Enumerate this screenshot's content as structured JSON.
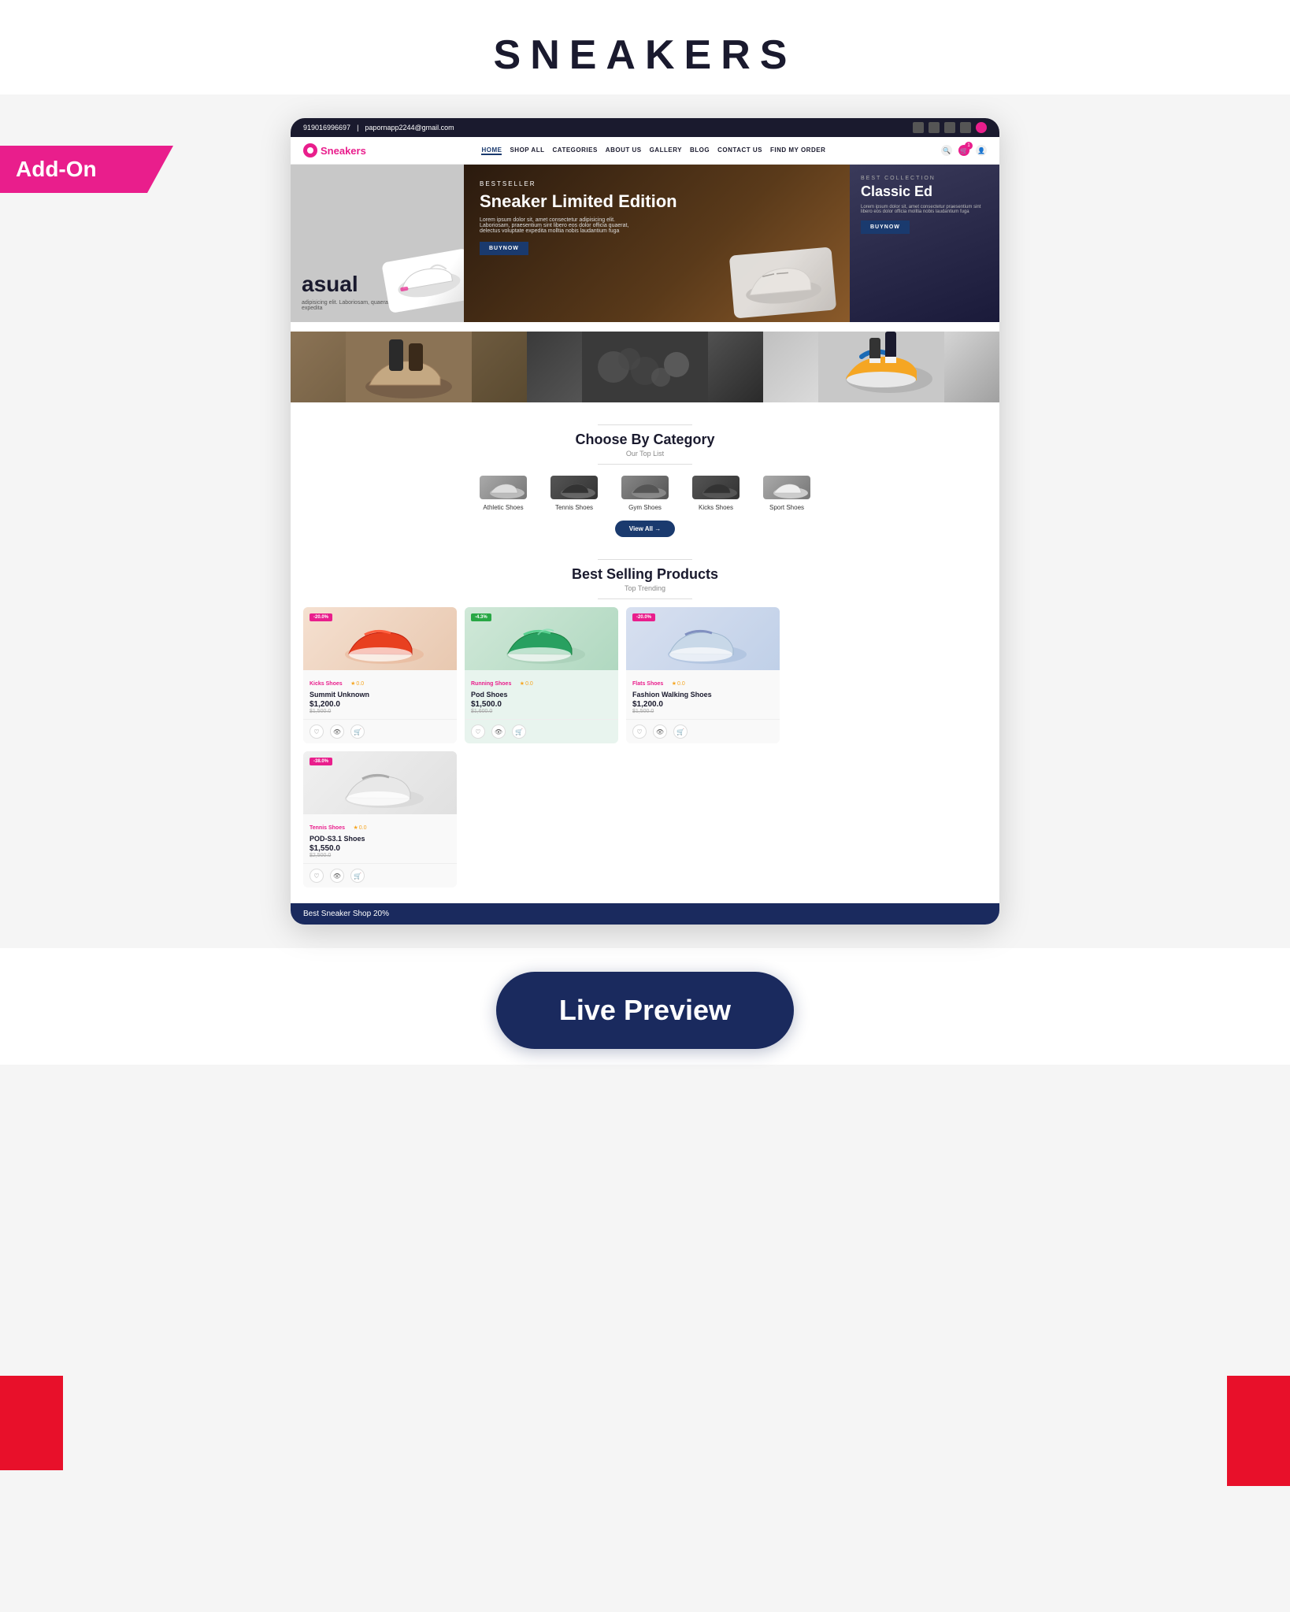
{
  "page": {
    "title": "SNEAKERS",
    "addon_badge": "Add-On"
  },
  "topbar": {
    "phone": "919016996697",
    "email": "papornapp2244@gmail.com",
    "social_icons": [
      "facebook",
      "twitter",
      "instagram",
      "linkedin",
      "user"
    ]
  },
  "nav": {
    "logo": "Sneakers",
    "links": [
      "HOME",
      "SHOP ALL",
      "CATEGORIES",
      "ABOUT US",
      "GALLERY",
      "BLOG",
      "CONTACT US",
      "FIND MY ORDER"
    ],
    "active": "HOME"
  },
  "hero": {
    "left": {
      "label": "asual",
      "text": "adipisicing elit. Laboriosam, quaerat, delectus voluptate expedita"
    },
    "center": {
      "subtitle": "BESTSELLER",
      "title": "Sneaker Limited Edition",
      "description": "Lorem ipsum dolor sit, amet consectetur adipisicing elit. Laboriosam, praesentium sint libero eos dolor officia quaerat, delectus voluptate expedita molltia nobis laudantium fuga",
      "button": "BUYNOW"
    },
    "right": {
      "subtitle": "BEST COLLECTION",
      "title": "Classic Ed",
      "description": "Lorem ipsum dolor sit, amet consectetur praesentium sint libero eos dolor officia molltia nobis laudantium fuga",
      "button": "BUYNOW"
    }
  },
  "gallery": {
    "items": [
      "outdoor-shoe",
      "collection-shoes",
      "colorful-shoe"
    ]
  },
  "categories": {
    "section_title": "Choose By Category",
    "section_subtitle": "Our Top List",
    "view_all": "View All →",
    "items": [
      {
        "name": "Athletic Shoes",
        "type": "light"
      },
      {
        "name": "Tennis Shoes",
        "type": "dark"
      },
      {
        "name": "Gym Shoes",
        "type": "medium"
      },
      {
        "name": "Kicks Shoes",
        "type": "dark"
      },
      {
        "name": "Sport Shoes",
        "type": "light"
      }
    ]
  },
  "best_selling": {
    "section_title": "Best Selling Products",
    "section_subtitle": "Top Trending",
    "products": [
      {
        "badge": "-20.0%",
        "badge_color": "red",
        "category": "Kicks Shoes",
        "rating": "0.0",
        "name": "Summit Unknown",
        "price": "$1,200.0",
        "old_price": "$1,500.0",
        "img_type": "red"
      },
      {
        "badge": "-4.3%",
        "badge_color": "green",
        "category": "Running Shoes",
        "rating": "0.0",
        "name": "Pod Shoes",
        "price": "$1,500.0",
        "old_price": "$1,600.0",
        "img_type": "green"
      },
      {
        "badge": "-20.0%",
        "badge_color": "red",
        "category": "Flats Shoes",
        "rating": "0.0",
        "name": "Fashion Walking Shoes",
        "price": "$1,200.0",
        "old_price": "$1,500.0",
        "img_type": "blue"
      },
      {
        "badge": "-38.0%",
        "badge_color": "red",
        "category": "Tennis Shoes",
        "rating": "0.0",
        "name": "POD-S3.1 Shoes",
        "price": "$1,550.0",
        "old_price": "$2,500.0",
        "img_type": "gray"
      }
    ]
  },
  "live_preview": {
    "button_label": "Live Preview"
  },
  "bottom_ticker": {
    "text": "Best Sneaker Shop 20%"
  }
}
